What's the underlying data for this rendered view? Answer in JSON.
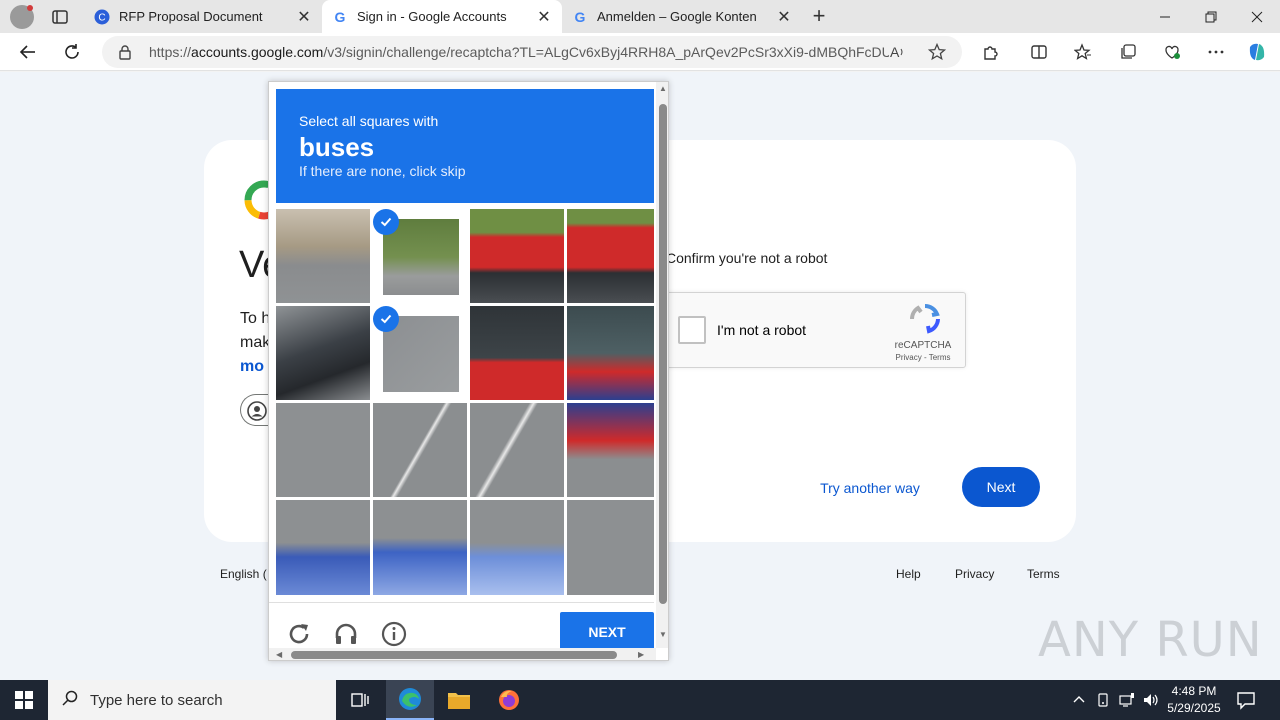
{
  "browser": {
    "tabs": [
      {
        "label": "RFP Proposal Document",
        "active": false
      },
      {
        "label": "Sign in - Google Accounts",
        "active": true
      },
      {
        "label": "Anmelden – Google Konten",
        "active": false
      }
    ],
    "url_prefix": "https://",
    "url_domain": "accounts.google.com",
    "url_rest": "/v3/signin/challenge/recaptcha?TL=ALgCv6xByj4RRH8A_pArQev2PcSr3xXi9-dMBQhFcDU..."
  },
  "page": {
    "heading_partial": "Ve",
    "para_line1": "To h",
    "para_line2": "mak",
    "para_link": "mo",
    "confirm_text": "Confirm you're not a robot",
    "recaptcha_label": "I'm not a robot",
    "recaptcha_brand": "reCAPTCHA",
    "recaptcha_links": "Privacy - Terms",
    "try_another": "Try another way",
    "next": "Next",
    "footer_lang": "English (",
    "footer_help": "Help",
    "footer_privacy": "Privacy",
    "footer_terms": "Terms"
  },
  "captcha": {
    "instruction": "Select all squares with",
    "target": "buses",
    "hint": "If there are none, click skip",
    "next_label": "NEXT",
    "grid_rows": 4,
    "grid_cols": 4,
    "selected_tiles": [
      1,
      5
    ]
  },
  "watermark": "ANY RUN",
  "taskbar": {
    "search_placeholder": "Type here to search",
    "time": "4:48 PM",
    "date": "5/29/2025"
  },
  "colors": {
    "accent": "#0b57d0",
    "captcha_blue": "#1a73e8",
    "taskbar": "#1e2633"
  }
}
